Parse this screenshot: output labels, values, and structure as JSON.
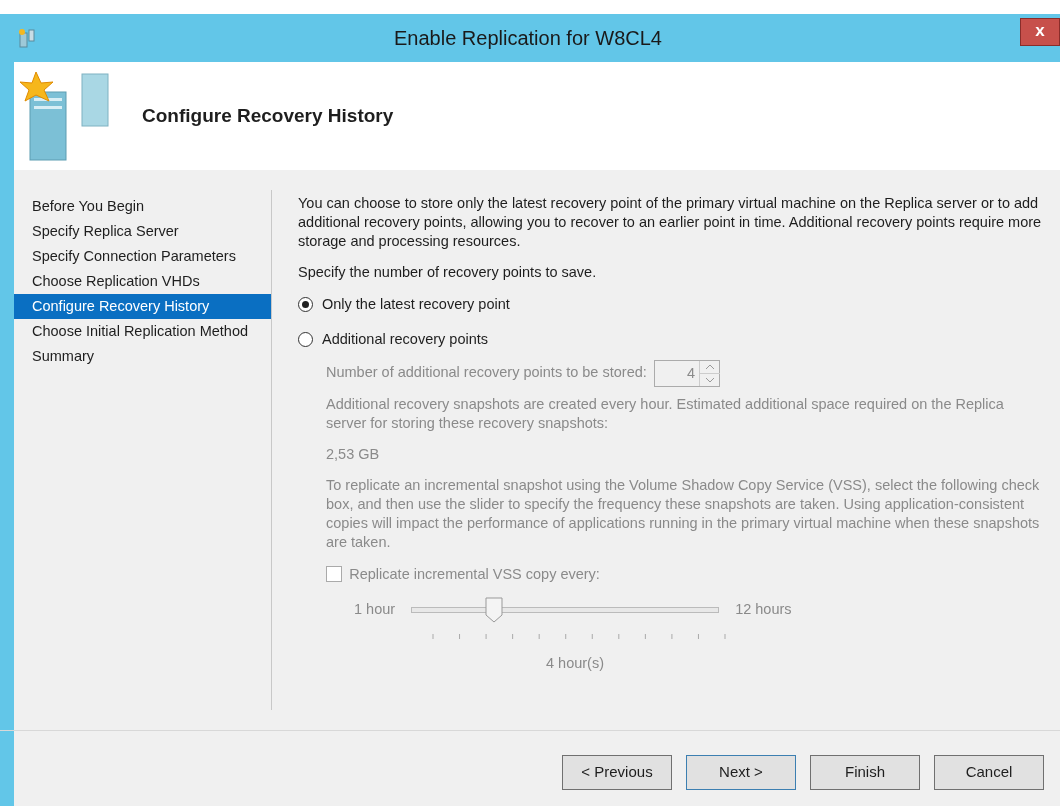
{
  "window": {
    "title": "Enable Replication for W8CL4",
    "close_label": "x"
  },
  "header": {
    "title": "Configure Recovery History"
  },
  "steps": [
    {
      "label": "Before You Begin",
      "selected": false
    },
    {
      "label": "Specify Replica Server",
      "selected": false
    },
    {
      "label": "Specify Connection Parameters",
      "selected": false
    },
    {
      "label": "Choose Replication VHDs",
      "selected": false
    },
    {
      "label": "Configure Recovery History",
      "selected": true
    },
    {
      "label": "Choose Initial Replication Method",
      "selected": false
    },
    {
      "label": "Summary",
      "selected": false
    }
  ],
  "content": {
    "intro": "You can choose to store only the latest recovery point of the primary virtual machine on the Replica server or to add additional recovery points, allowing you to recover to an earlier point in time. Additional recovery points require more storage and processing resources.",
    "prompt": "Specify the number of recovery points to save.",
    "options": [
      {
        "label": "Only the latest recovery point",
        "selected": true
      },
      {
        "label": "Additional recovery points",
        "selected": false
      }
    ],
    "additional": {
      "disabled": true,
      "count_label": "Number of additional recovery points to be stored:",
      "count_value": "4",
      "space_note": "Additional recovery snapshots are created every hour. Estimated additional space required on the Replica server for storing these recovery snapshots:",
      "space_value": "2,53 GB",
      "vss_note": "To replicate an incremental snapshot using the Volume Shadow Copy Service (VSS), select the following check box, and then use the slider to specify the frequency these snapshots are taken. Using application-consistent copies will impact the performance of applications running in the primary virtual machine when these snapshots are taken.",
      "vss_checkbox": {
        "label": "Replicate incremental VSS copy every:",
        "checked": false
      },
      "slider": {
        "min_label": "1 hour",
        "max_label": "12 hours",
        "level": 0.27,
        "reading": "4 hour(s)"
      }
    }
  },
  "buttons": [
    {
      "label": "< Previous",
      "focused": false
    },
    {
      "label": "Next >",
      "focused": true
    },
    {
      "label": "Finish",
      "focused": false
    },
    {
      "label": "Cancel",
      "focused": false
    }
  ]
}
